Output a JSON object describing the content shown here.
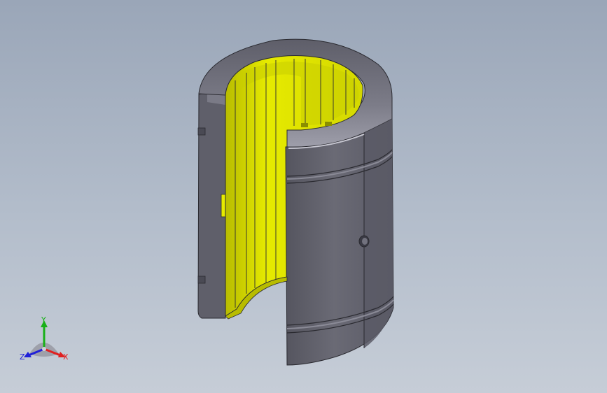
{
  "viewport": {
    "model": "linear-bushing-section-view",
    "colors": {
      "background_top": "#9aa6b8",
      "background_bottom": "#c6cdd7",
      "housing": "#62626d",
      "housing_light": "#8a8a96",
      "section_face": "#e6ea00",
      "inner_dark": "#55555f"
    }
  },
  "triad": {
    "x_label": "X",
    "y_label": "Y",
    "z_label": "Z",
    "colors": {
      "x": "#e02020",
      "y": "#18b018",
      "z": "#2020d8"
    }
  }
}
